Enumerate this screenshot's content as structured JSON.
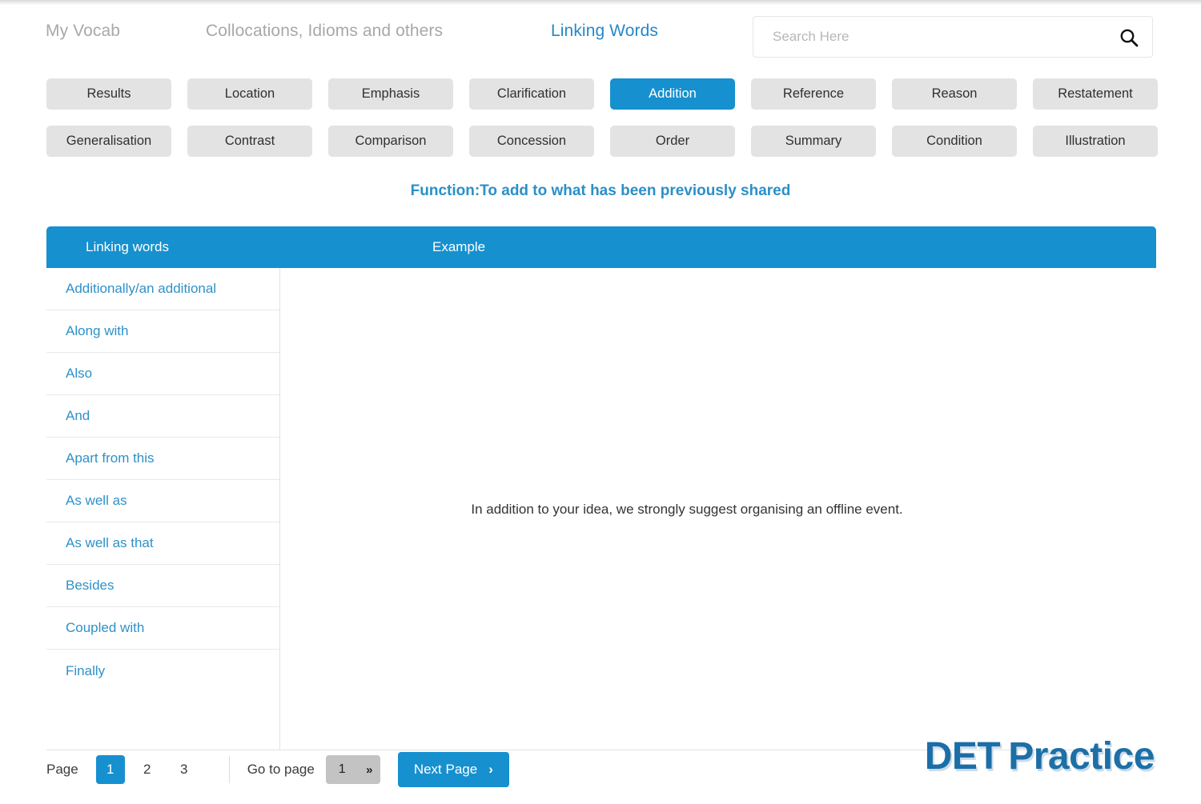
{
  "header": {
    "nav": [
      {
        "label": "My Vocab",
        "active": false
      },
      {
        "label": "Collocations, Idioms and others",
        "active": false
      },
      {
        "label": "Linking Words",
        "active": true
      }
    ],
    "search": {
      "placeholder": "Search Here",
      "value": "",
      "icon": "search-icon"
    }
  },
  "categories": [
    {
      "label": "Results",
      "active": false
    },
    {
      "label": "Location",
      "active": false
    },
    {
      "label": "Emphasis",
      "active": false
    },
    {
      "label": "Clarification",
      "active": false
    },
    {
      "label": "Addition",
      "active": true
    },
    {
      "label": "Reference",
      "active": false
    },
    {
      "label": "Reason",
      "active": false
    },
    {
      "label": "Restatement",
      "active": false
    },
    {
      "label": "Generalisation",
      "active": false
    },
    {
      "label": "Contrast",
      "active": false
    },
    {
      "label": "Comparison",
      "active": false
    },
    {
      "label": "Concession",
      "active": false
    },
    {
      "label": "Order",
      "active": false
    },
    {
      "label": "Summary",
      "active": false
    },
    {
      "label": "Condition",
      "active": false
    },
    {
      "label": "Illustration",
      "active": false
    }
  ],
  "function_line": "Function:To add to what has been previously shared",
  "table": {
    "columns": {
      "linking_words": "Linking words",
      "example": "Example"
    },
    "rows": [
      {
        "word": "Additionally/an additional"
      },
      {
        "word": "Along with"
      },
      {
        "word": "Also"
      },
      {
        "word": "And"
      },
      {
        "word": "Apart from this"
      },
      {
        "word": "As well as"
      },
      {
        "word": "As well as that"
      },
      {
        "word": "Besides"
      },
      {
        "word": "Coupled with"
      },
      {
        "word": "Finally"
      }
    ],
    "example_text": "In addition to your idea, we strongly suggest organising an offline event."
  },
  "pagination": {
    "page_label": "Page",
    "pages": [
      {
        "number": "1",
        "active": true
      },
      {
        "number": "2",
        "active": false
      },
      {
        "number": "3",
        "active": false
      }
    ],
    "goto_label": "Go to page",
    "goto_value": "1",
    "goto_chevron": "»",
    "next_label": "Next Page",
    "next_chevron": "›"
  },
  "logo": {
    "part1": "DET",
    "part2": "Practice"
  },
  "colors": {
    "accent_blue": "#1690cf",
    "nav_blue": "#2488c8",
    "button_gray": "#e3e3e3",
    "word_blue": "#2e91c9",
    "logo_blue": "#1c6fa8"
  }
}
